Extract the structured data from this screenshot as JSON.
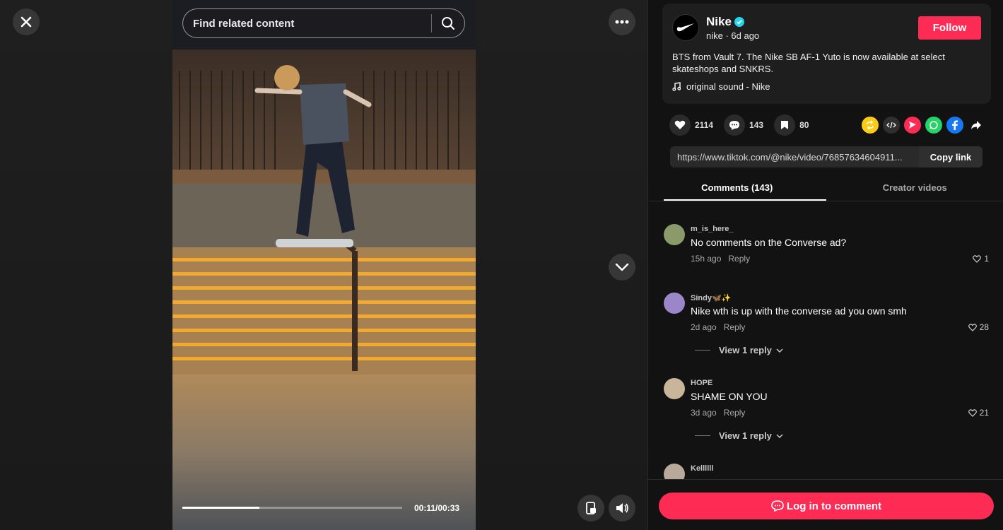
{
  "search": {
    "placeholder": "Find related content"
  },
  "player": {
    "time": "00:11/00:33",
    "progress_fraction": 0.35
  },
  "post": {
    "author": "Nike",
    "handle_time": "nike · 6d ago",
    "follow_label": "Follow",
    "description": "BTS from Vault 7. The Nike SB AF-1 Yuto is now available at select skateshops and SNKRS.",
    "sound": "original sound - Nike"
  },
  "stats": {
    "likes": "2114",
    "comments": "143",
    "saves": "80"
  },
  "share": {
    "url": "https://www.tiktok.com/@nike/video/76857634604911...",
    "copy_label": "Copy link"
  },
  "tabs": [
    {
      "label": "Comments (143)"
    },
    {
      "label": "Creator videos"
    }
  ],
  "comments": [
    {
      "user": "m_is_here_",
      "text": "No comments on the Converse ad?",
      "time": "15h ago",
      "reply": "Reply",
      "likes": "1",
      "avatar_color": "#8a9a6a"
    },
    {
      "user": "Sindy🦋✨",
      "text": "Nike wth is up with the converse ad you own smh",
      "time": "2d ago",
      "reply": "Reply",
      "likes": "28",
      "view_replies": "View 1 reply",
      "avatar_color": "#9a86c9"
    },
    {
      "user": "HOPE",
      "text": "SHAME ON YOU",
      "time": "3d ago",
      "reply": "Reply",
      "likes": "21",
      "view_replies": "View 1 reply",
      "avatar_color": "#c9b59a"
    },
    {
      "user": "Kellllll",
      "avatar_color": "#b9a99a"
    }
  ],
  "bottom": {
    "login_label": "Log in to comment"
  },
  "colors": {
    "accent": "#fe2c55"
  }
}
